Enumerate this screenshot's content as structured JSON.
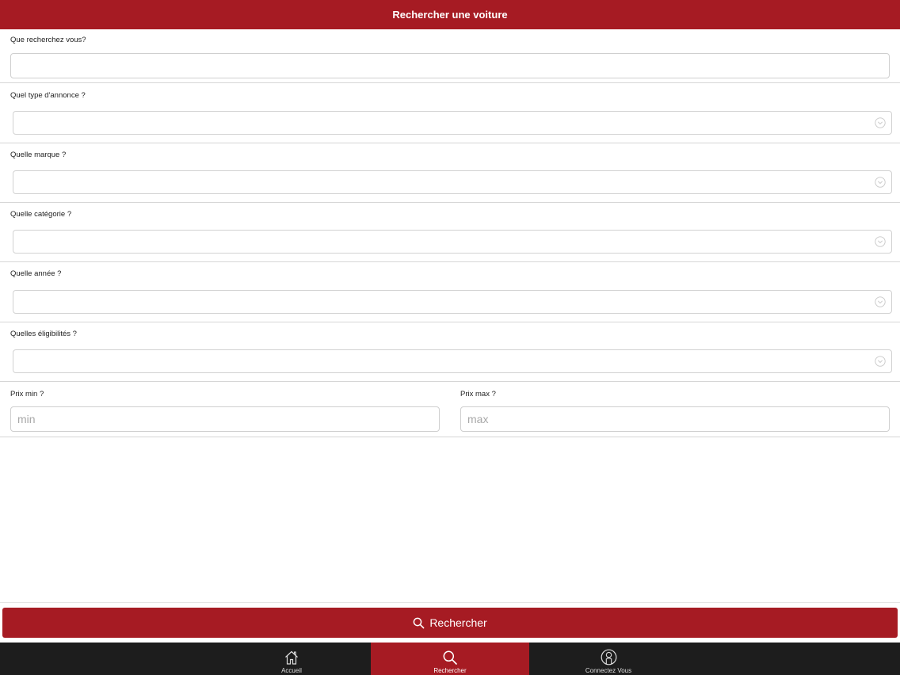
{
  "header": {
    "title": "Rechercher une voiture"
  },
  "form": {
    "query": {
      "label": "Que recherchez vous?",
      "value": ""
    },
    "ad_type": {
      "label": "Quel type d'annonce ?",
      "value": ""
    },
    "brand": {
      "label": "Quelle marque ?",
      "value": ""
    },
    "category": {
      "label": "Quelle catégorie ?",
      "value": ""
    },
    "year": {
      "label": "Quelle année ?",
      "value": ""
    },
    "eligibility": {
      "label": "Quelles éligibilités ?",
      "value": ""
    },
    "price_min": {
      "label": "Prix min ?",
      "placeholder": "min",
      "value": ""
    },
    "price_max": {
      "label": "Prix max ?",
      "placeholder": "max",
      "value": ""
    }
  },
  "search_button": {
    "label": "Rechercher",
    "icon": "search-icon"
  },
  "tabbar": {
    "items": [
      {
        "label": "Accueil",
        "icon": "home-icon",
        "active": false
      },
      {
        "label": "Rechercher",
        "icon": "search-icon",
        "active": true
      },
      {
        "label": "Connectez Vous",
        "icon": "user-icon",
        "active": false
      }
    ]
  },
  "colors": {
    "accent": "#a61b23",
    "tabbar_bg": "#1d1d1d"
  }
}
